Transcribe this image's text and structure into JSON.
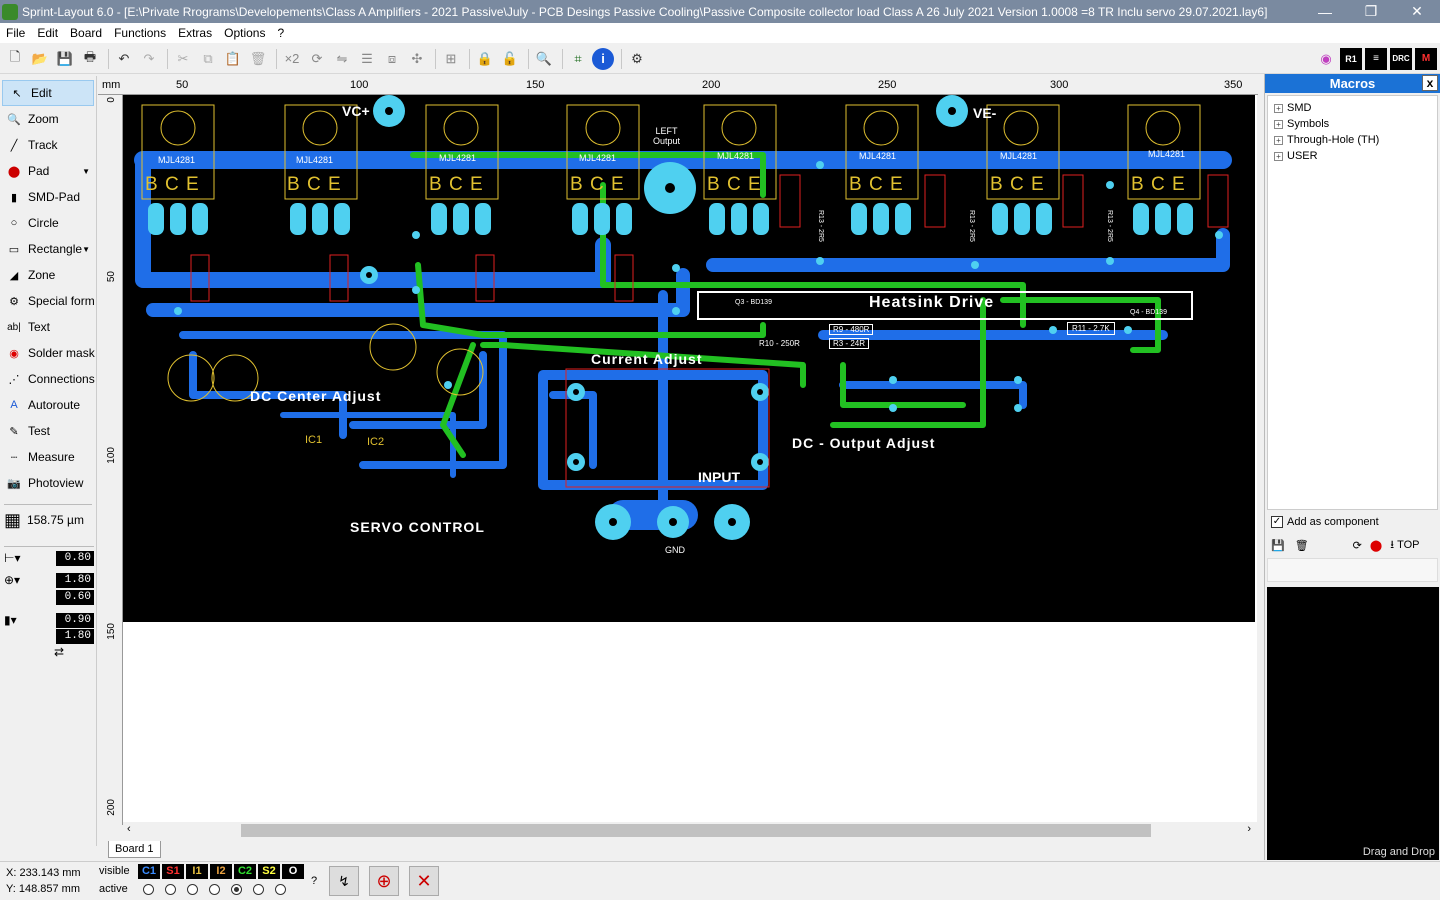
{
  "window": {
    "title": "Sprint-Layout 6.0 - [E:\\Private Rrograms\\Developements\\Class A Amplifiers - 2021 Passive\\July - PCB Desings Passive Cooling\\Passive Composite collector load Class A 26 July 2021 Version 1.0008 =8 TR Inclu servo 29.07.2021.lay6]",
    "minimize": "—",
    "restore": "❐",
    "close": "✕"
  },
  "menu": [
    "File",
    "Edit",
    "Board",
    "Functions",
    "Extras",
    "Options",
    "?"
  ],
  "tools": [
    {
      "label": "Edit",
      "icon": "cursor-icon"
    },
    {
      "label": "Zoom",
      "icon": "zoom-icon"
    },
    {
      "label": "Track",
      "icon": "track-icon"
    },
    {
      "label": "Pad",
      "icon": "pad-icon"
    },
    {
      "label": "SMD-Pad",
      "icon": "smd-pad-icon"
    },
    {
      "label": "Circle",
      "icon": "circle-icon"
    },
    {
      "label": "Rectangle",
      "icon": "rectangle-icon"
    },
    {
      "label": "Zone",
      "icon": "zone-icon"
    },
    {
      "label": "Special form",
      "icon": "special-form-icon"
    },
    {
      "label": "Text",
      "icon": "text-icon"
    },
    {
      "label": "Solder mask",
      "icon": "solder-mask-icon"
    },
    {
      "label": "Connections",
      "icon": "connections-icon"
    },
    {
      "label": "Autoroute",
      "icon": "autoroute-icon"
    },
    {
      "label": "Test",
      "icon": "test-icon"
    },
    {
      "label": "Measure",
      "icon": "measure-icon"
    },
    {
      "label": "Photoview",
      "icon": "photoview-icon"
    }
  ],
  "grid": {
    "value": "158.75 µm"
  },
  "params": {
    "track_width": "0.80",
    "pad_outer": "1.80",
    "pad_inner": "0.60",
    "smd_w": "0.90",
    "smd_h": "1.80"
  },
  "ruler": {
    "unit": "mm",
    "top_ticks": [
      "50",
      "100",
      "150",
      "200",
      "250",
      "300",
      "350"
    ],
    "left_ticks": [
      "0",
      "50",
      "100",
      "150",
      "200"
    ]
  },
  "pcb": {
    "labels": {
      "vc": "VC+",
      "ve": "VE-",
      "left_output_1": "LEFT",
      "left_output_2": "Output",
      "heatsink": "Heatsink Drive",
      "current_adjust": "Current Adjust",
      "dc_center": "DC Center Adjust",
      "dc_output": "DC - Output Adjust",
      "input": "INPUT",
      "servo": "SERVO CONTROL",
      "gnd": "GND",
      "ic1": "IC1",
      "ic2": "IC2",
      "transistor": "MJL4281",
      "pins": "B C E",
      "r11": "R11 - 2.7K",
      "r9": "R9 - 480R",
      "r3": "R3 - 24R",
      "r10": "R10 - 250R",
      "q3": "Q3 - BD139",
      "q4": "Q4 - BD139",
      "r13": "R13 - 2R5"
    }
  },
  "board_tab": "Board 1",
  "status": {
    "x": "X:  233.143 mm",
    "y": "Y:  148.857 mm",
    "visible": "visible",
    "active": "active",
    "layers": [
      {
        "name": "C1",
        "color": "#3a8cff"
      },
      {
        "name": "S1",
        "color": "#ff3030"
      },
      {
        "name": "I1",
        "color": "#e8c040"
      },
      {
        "name": "I2",
        "color": "#e8a040"
      },
      {
        "name": "C2",
        "color": "#30e030"
      },
      {
        "name": "S2",
        "color": "#ffff40"
      },
      {
        "name": "O",
        "color": "#ffffff"
      }
    ],
    "help": "?"
  },
  "macros": {
    "title": "Macros",
    "close": "x",
    "tree": [
      "SMD",
      "Symbols",
      "Through-Hole (TH)",
      "USER"
    ],
    "add_component": "Add as component",
    "top_label": "TOP",
    "drag_drop": "Drag and Drop"
  }
}
